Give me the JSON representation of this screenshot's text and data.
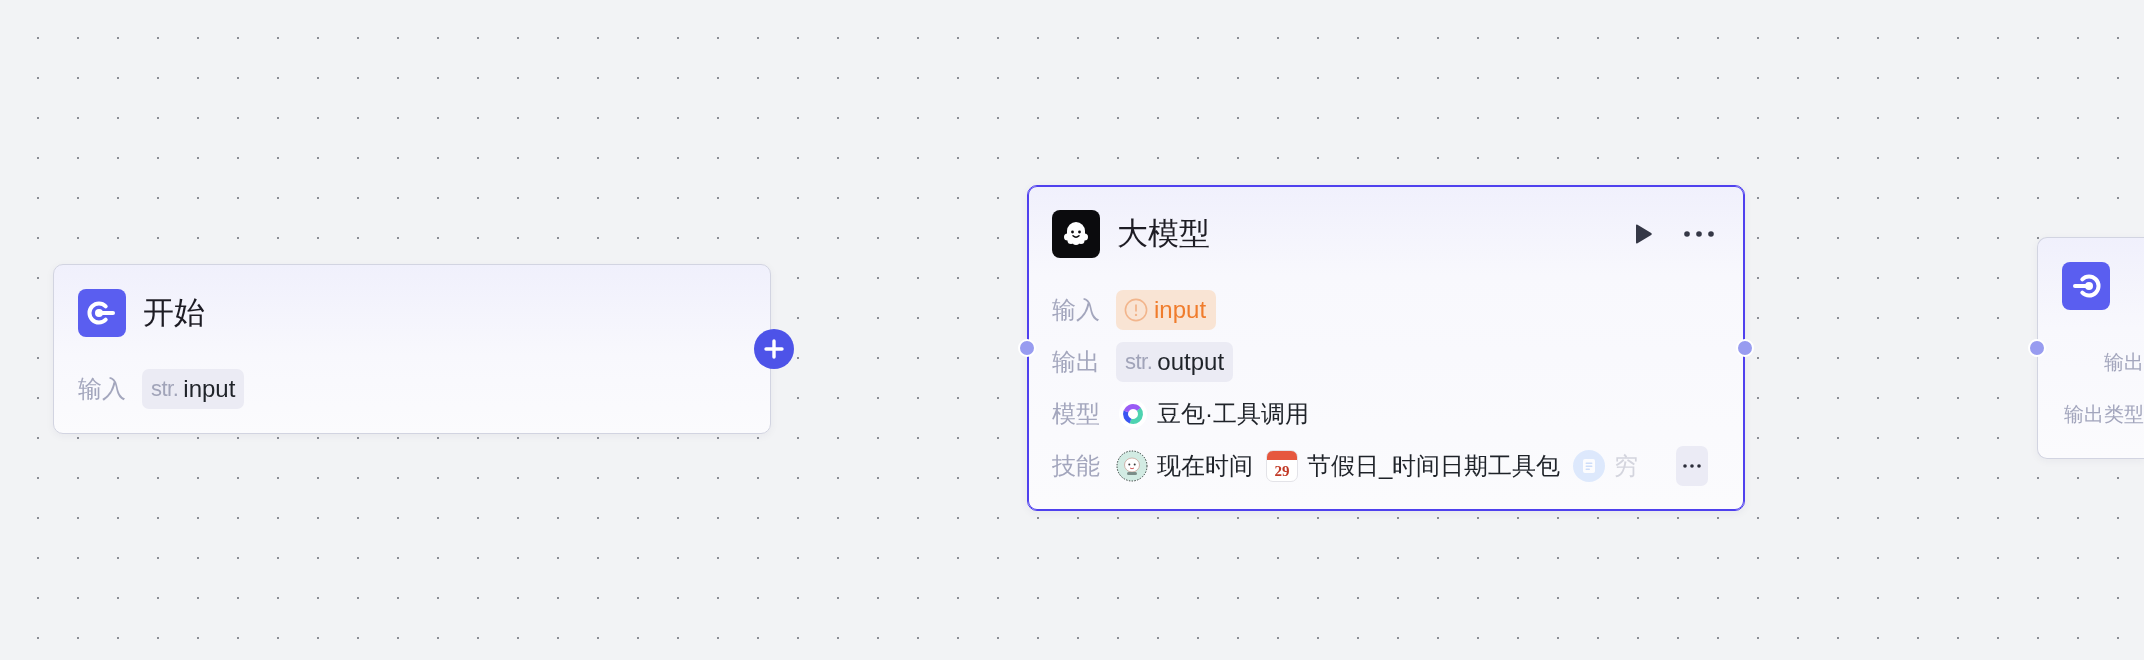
{
  "nodes": [
    {
      "kind": "start",
      "title": "开始",
      "selected": false,
      "add_button": true,
      "rows": [
        {
          "kind": "vars",
          "label": "输入",
          "vars": [
            {
              "type": "str.",
              "name": "input",
              "warning": false
            }
          ]
        }
      ]
    },
    {
      "kind": "llm",
      "title": "大模型",
      "selected": true,
      "actions": true,
      "ports": {
        "left": true,
        "right": true
      },
      "rows": [
        {
          "kind": "vars",
          "label": "输入",
          "vars": [
            {
              "name": "input",
              "warning": true
            }
          ]
        },
        {
          "kind": "vars",
          "label": "输出",
          "vars": [
            {
              "type": "str.",
              "name": "output",
              "warning": false
            }
          ]
        },
        {
          "kind": "model",
          "label": "模型",
          "value": "豆包·工具调用"
        },
        {
          "kind": "skills",
          "label": "技能",
          "more": true,
          "skills": [
            {
              "name": "现在时间",
              "faded": false
            },
            {
              "name": "节假日_时间日期工具包",
              "icon_text": "29",
              "faded": false
            },
            {
              "name": "穷",
              "faded": true
            }
          ]
        }
      ]
    },
    {
      "kind": "end",
      "selected": false,
      "ports": {
        "left": true
      },
      "rows": [
        {
          "kind": "text",
          "label": "输出"
        },
        {
          "kind": "text",
          "label": "输出类型"
        }
      ]
    }
  ]
}
